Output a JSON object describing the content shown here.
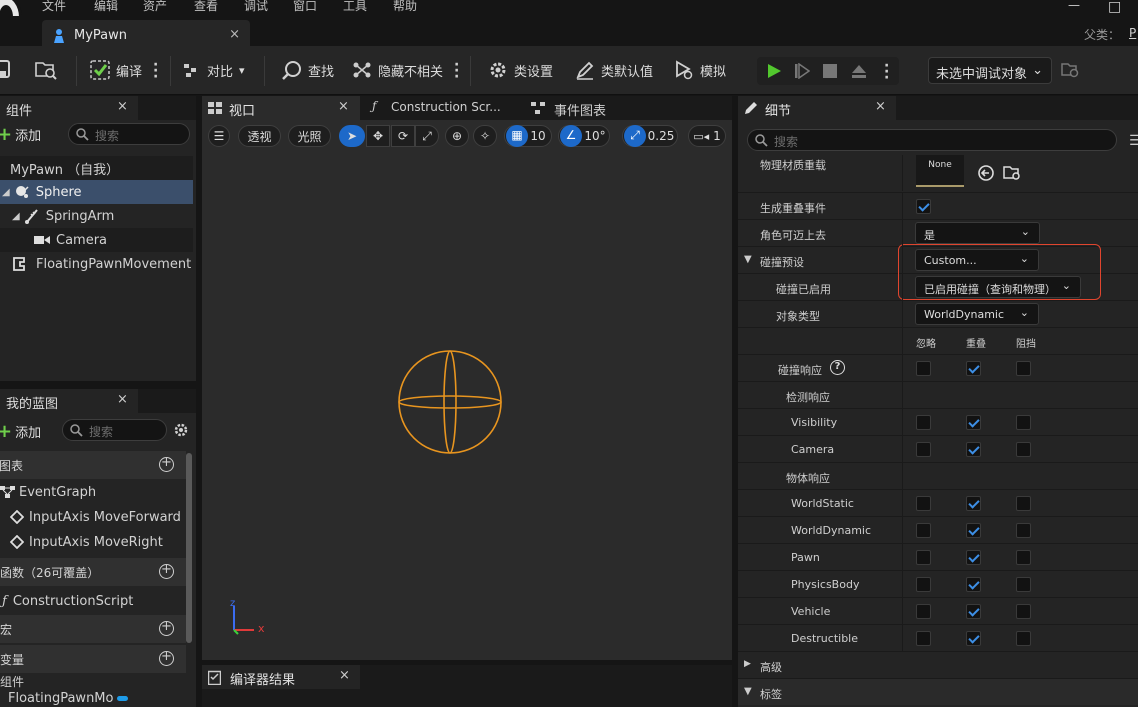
{
  "menu": [
    "文件",
    "编辑",
    "资产",
    "查看",
    "调试",
    "窗口",
    "工具",
    "帮助"
  ],
  "window": {
    "minimize": "—",
    "maximize": "□",
    "parent_label": "父类：",
    "parent_value": "P"
  },
  "document_tab": {
    "title": "MyPawn",
    "close": "×"
  },
  "toolbar": {
    "compile": "编译",
    "diff": "对比",
    "find": "查找",
    "hide_unrelated": "隐藏不相关",
    "class_settings": "类设置",
    "class_defaults": "类默认值",
    "simulate": "模拟",
    "debug_select": "未选中调试对象"
  },
  "components_panel": {
    "tab": "组件",
    "close": "×",
    "add": "添加",
    "search_placeholder": "搜索",
    "tree": [
      {
        "label": "MyPawn （自我）",
        "icon": "none"
      },
      {
        "label": "Sphere",
        "icon": "sphere-icon",
        "selected": true
      },
      {
        "label": "SpringArm",
        "icon": "springarm-icon"
      },
      {
        "label": "Camera",
        "icon": "camera-icon"
      },
      {
        "label": "FloatingPawnMovement",
        "icon": "movement-icon"
      }
    ]
  },
  "my_blueprint_panel": {
    "tab": "我的蓝图",
    "close": "×",
    "add": "添加",
    "search_placeholder": "搜索",
    "graphs_header": "图表",
    "graph_items": [
      "EventGraph",
      "InputAxis MoveForward",
      "InputAxis MoveRight"
    ],
    "functions_header": "函数（26可覆盖）",
    "function_items": [
      "ConstructionScript"
    ],
    "macros_header": "宏",
    "variables_header": "变量",
    "components_subheader": "组件",
    "variable_items": [
      "FloatingPawnMo"
    ]
  },
  "center_tabs": {
    "viewport": "视口",
    "construction": "Construction Scr...",
    "event_graph": "事件图表",
    "close": "×"
  },
  "viewport_toolbar": {
    "perspective": "透视",
    "lighting": "光照",
    "grid_snap": "10",
    "rotation_snap": "10°",
    "scale_snap": "0.25",
    "camera_speed": "1"
  },
  "axis_labels": {
    "z": "z",
    "x": "x"
  },
  "compiler_results": {
    "tab": "编译器结果",
    "close": "×"
  },
  "details_panel": {
    "tab": "细节",
    "close": "×",
    "search_placeholder": "搜索",
    "phys_material_label": "物理材质重载",
    "phys_material_value": "None",
    "generate_overlap_label": "生成重叠事件",
    "generate_overlap": true,
    "can_step_up_label": "角色可迈上去",
    "can_step_up_value": "是",
    "collision_presets_label": "碰撞预设",
    "collision_presets_value": "Custom...",
    "collision_enabled_label": "碰撞已启用",
    "collision_enabled_value": "已启用碰撞（查询和物理）",
    "object_type_label": "对象类型",
    "object_type_value": "WorldDynamic",
    "response_headers": [
      "忽略",
      "重叠",
      "阻挡"
    ],
    "collision_responses_label": "碰撞响应",
    "trace_responses_label": "检测响应",
    "object_responses_label": "物体响应",
    "responses": [
      {
        "name": "Visibility",
        "section": "trace",
        "value": "重叠"
      },
      {
        "name": "Camera",
        "section": "trace",
        "value": "重叠"
      },
      {
        "name": "WorldStatic",
        "section": "object",
        "value": "重叠"
      },
      {
        "name": "WorldDynamic",
        "section": "object",
        "value": "重叠"
      },
      {
        "name": "Pawn",
        "section": "object",
        "value": "重叠"
      },
      {
        "name": "PhysicsBody",
        "section": "object",
        "value": "重叠"
      },
      {
        "name": "Vehicle",
        "section": "object",
        "value": "重叠"
      },
      {
        "name": "Destructible",
        "section": "object",
        "value": "重叠"
      }
    ],
    "advanced_label": "高级",
    "tags_label": "标签"
  },
  "colors": {
    "accent_blue": "#1d69c9",
    "play_green": "#52c72e",
    "highlight_red": "#e0452e",
    "sphere_orange": "#e8951f",
    "selected_row": "#3b4f6b"
  }
}
